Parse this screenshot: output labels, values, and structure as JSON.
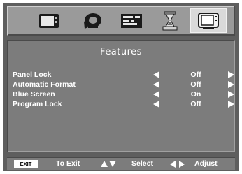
{
  "tabs": [
    {
      "icon": "tv-picture-icon",
      "active": false
    },
    {
      "icon": "sound-speaker-icon",
      "active": false
    },
    {
      "icon": "channel-tuning-icon",
      "active": false
    },
    {
      "icon": "timer-hourglass-icon",
      "active": false
    },
    {
      "icon": "features-tv-icon",
      "active": true
    }
  ],
  "menu": {
    "title": "Features",
    "items": [
      {
        "label": "Panel Lock",
        "value": "Off"
      },
      {
        "label": "Automatic Format",
        "value": "Off"
      },
      {
        "label": "Blue Screen",
        "value": "On"
      },
      {
        "label": "Program Lock",
        "value": "Off"
      }
    ]
  },
  "footer": {
    "exit_badge": "EXIT",
    "exit_label": "To Exit",
    "select_label": "Select",
    "adjust_label": "Adjust"
  },
  "colors": {
    "frame": "#5e5e5e",
    "panel": "#7c7c7c",
    "tabbar": "#9a9a9a",
    "active_tab": "#d9d9d9",
    "text": "#ffffff"
  }
}
